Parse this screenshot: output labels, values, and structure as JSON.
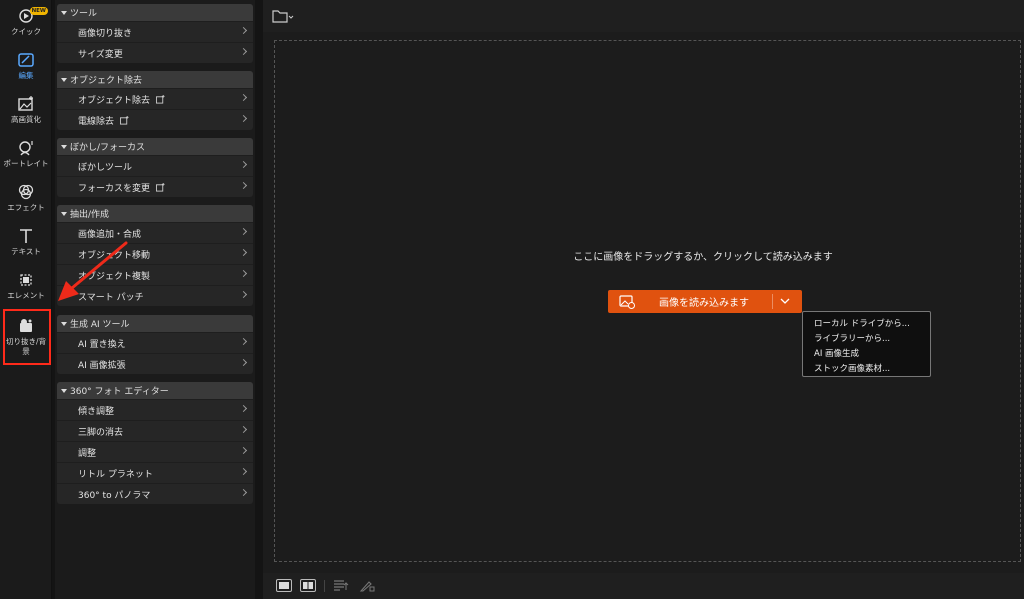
{
  "rail": {
    "items": [
      {
        "label": "クイック",
        "icon": "quick-icon",
        "badge": "NEW"
      },
      {
        "label": "編集",
        "icon": "edit-icon"
      },
      {
        "label": "高画質化",
        "icon": "enhance-icon"
      },
      {
        "label": "ポートレイト",
        "icon": "portrait-icon"
      },
      {
        "label": "エフェクト",
        "icon": "effect-icon"
      },
      {
        "label": "テキスト",
        "icon": "text-icon"
      },
      {
        "label": "エレメント",
        "icon": "element-icon"
      },
      {
        "label": "切り抜き/背景",
        "icon": "cutout-icon"
      }
    ]
  },
  "panel": {
    "groups": [
      {
        "title": "ツール",
        "items": [
          "画像切り抜き",
          "サイズ変更"
        ]
      },
      {
        "title": "オブジェクト除去",
        "items": [
          "オブジェクト除去",
          "電線除去"
        ]
      },
      {
        "title": "ぼかし/フォーカス",
        "items": [
          "ぼかしツール",
          "フォーカスを変更"
        ]
      },
      {
        "title": "抽出/作成",
        "items": [
          "画像追加・合成",
          "オブジェクト移動",
          "オブジェクト複製",
          "スマート パッチ"
        ]
      },
      {
        "title": "生成 AI ツール",
        "items": [
          "AI 置き換え",
          "AI 画像拡張"
        ]
      },
      {
        "title": "360° フォト エディター",
        "items": [
          "傾き調整",
          "三脚の消去",
          "調整",
          "リトル プラネット",
          "360° to パノラマ"
        ]
      }
    ]
  },
  "main": {
    "drop_text": "ここに画像をドラッグするか、クリックして読み込みます",
    "load_button": "画像を読み込みます",
    "menu": [
      "ローカル ドライブから...",
      "ライブラリーから...",
      "AI 画像生成",
      "ストック画像素材..."
    ]
  },
  "colors": {
    "accent": "#e0520f",
    "active_blue": "#5aa9ff",
    "highlight": "#ff2a1a"
  }
}
